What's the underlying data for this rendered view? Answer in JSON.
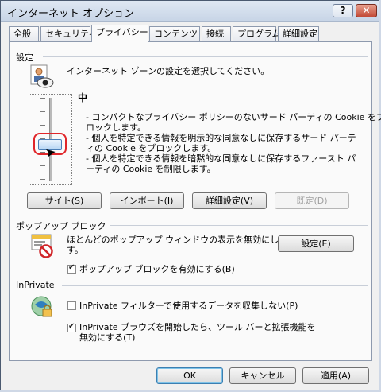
{
  "window": {
    "title": "インターネット オプション",
    "help_label": "?",
    "close_label": "✕"
  },
  "tabs": [
    {
      "label": "全般"
    },
    {
      "label": "セキュリティ"
    },
    {
      "label": "プライバシー"
    },
    {
      "label": "コンテンツ"
    },
    {
      "label": "接続"
    },
    {
      "label": "プログラム"
    },
    {
      "label": "詳細設定"
    }
  ],
  "settings": {
    "group_label": "設定",
    "zone_text": "インターネット ゾーンの設定を選択してください。",
    "level_title": "中",
    "description": [
      "- コンパクトなプライバシー ポリシーのないサード パーティの Cookie をブ",
      "ロックします。",
      "- 個人を特定できる情報を明示的な同意なしに保存するサード パーテ",
      "ィの Cookie をブロックします。",
      "- 個人を特定できる情報を暗黙的な同意なしに保存するファースト パ",
      "ーティの Cookie を制限します。"
    ],
    "slider_value": "中",
    "buttons": {
      "sites": "サイト(S)",
      "import": "インポート(I)",
      "advanced": "詳細設定(V)",
      "default": "既定(D)"
    }
  },
  "popup": {
    "group_label": "ポップアップ ブロック",
    "text_line1": "ほとんどのポップアップ ウィンドウの表示を無効にしま",
    "text_line2": "す。",
    "settings_button": "設定(E)",
    "checkbox_label": "ポップアップ ブロックを有効にする(B)",
    "checkbox_checked": true
  },
  "inprivate": {
    "group_label": "InPrivate",
    "filter_checkbox_label": "InPrivate フィルターで使用するデータを収集しない(P)",
    "filter_checked": false,
    "browse_checkbox_line1": "InPrivate ブラウズを開始したら、ツール バーと拡張機能を",
    "browse_checkbox_line2": "無効にする(T)",
    "browse_checked": true
  },
  "footer": {
    "ok": "OK",
    "cancel": "キャンセル",
    "apply": "適用(A)"
  }
}
